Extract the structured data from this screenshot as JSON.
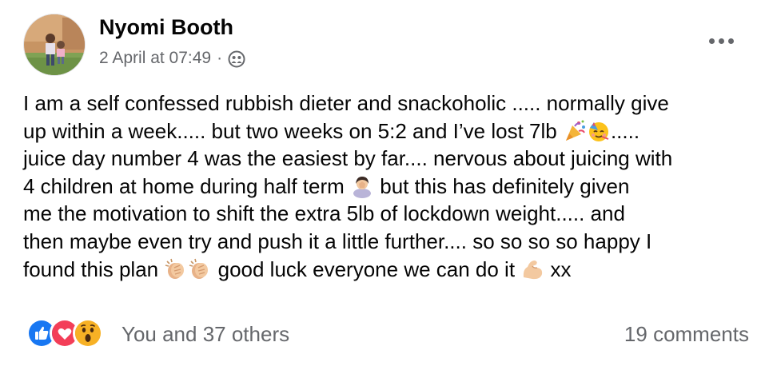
{
  "post": {
    "author": "Nyomi Booth",
    "date": "2 April at 07:49",
    "separator": "·",
    "audience_icon": "friends-icon",
    "more_icon": "more-options-icon",
    "text_lines": [
      {
        "text": "I am a self confessed rubbish dieter and snackoholic ..... normally give"
      },
      {
        "text": "up within a week..... but two weeks on 5:2 and I’ve lost 7lb",
        "after_emoji": ".....",
        "emojis": [
          "party-popper-icon",
          "partying-face-icon"
        ]
      },
      {
        "text": "juice day number 4 was the easiest by far.... nervous about juicing with"
      },
      {
        "text": "4 children at home during half term",
        "emojis": [
          "face-palm-icon"
        ],
        "after_emoji": "but this has definitely given"
      },
      {
        "text": "me the motivation to shift the extra 5lb of lockdown weight..... and"
      },
      {
        "text": "then maybe even try and push it a little further.... so so so so happy I"
      },
      {
        "text": "found this plan",
        "emojis": [
          "clapping-hands-icon",
          "clapping-hands-icon"
        ],
        "after_emoji": "good luck everyone we can do it",
        "emojis2": [
          "flexed-biceps-icon"
        ],
        "tail": "xx"
      }
    ]
  },
  "reactions": {
    "icons": [
      "like-icon",
      "love-icon",
      "wow-icon"
    ],
    "colors": {
      "like": "#1877f2",
      "love": "#f33e58",
      "wow": "#f7b125"
    },
    "summary": "You and 37 others"
  },
  "comments": {
    "label": "19 comments"
  }
}
